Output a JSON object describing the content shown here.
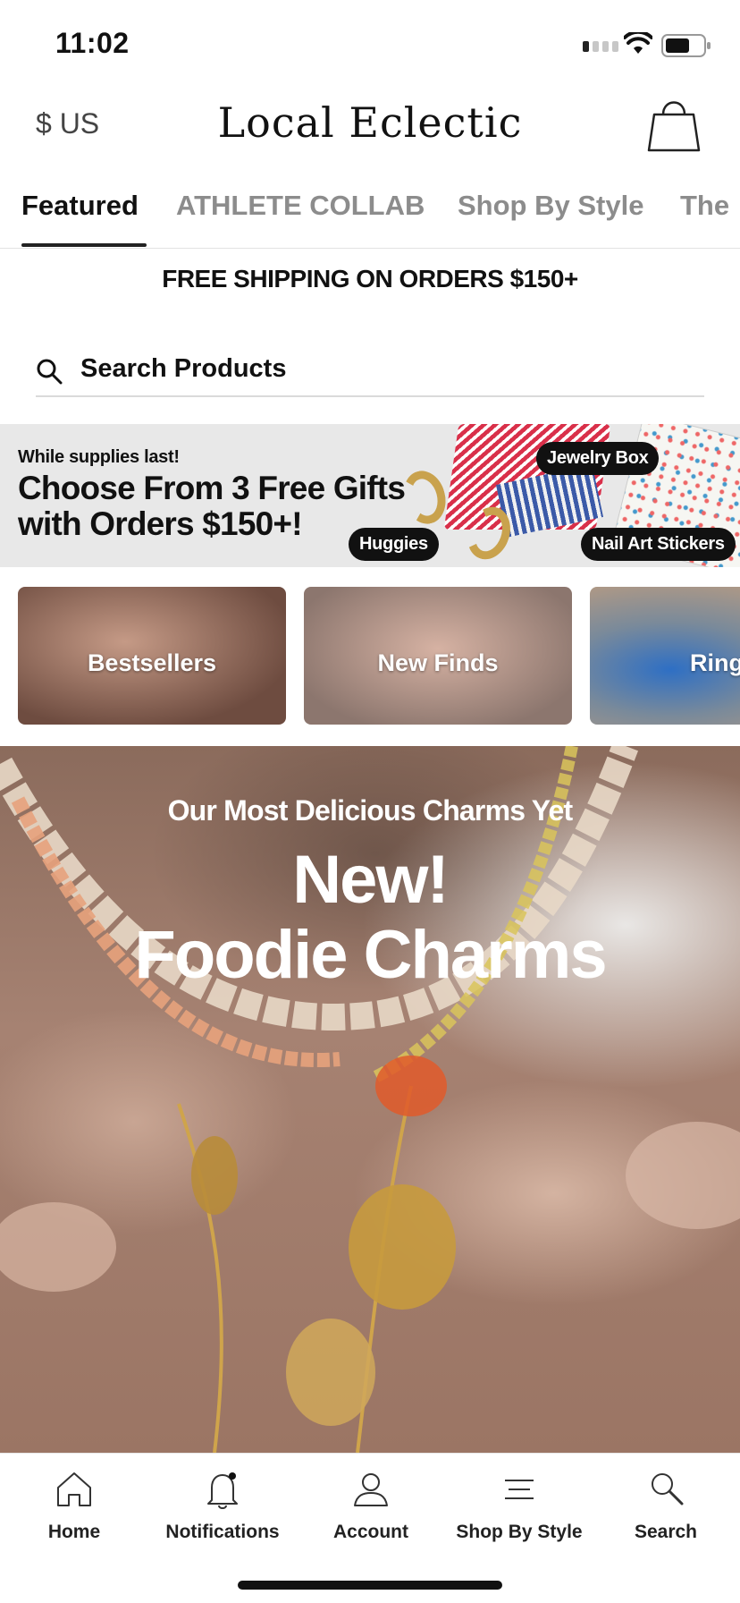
{
  "status_bar": {
    "time": "11:02"
  },
  "header": {
    "currency": "$ US",
    "brand": "Local Eclectic",
    "bag_icon": "shopping-bag-icon"
  },
  "tabs": [
    {
      "label": "Featured",
      "active": true
    },
    {
      "label": "ATHLETE COLLAB",
      "active": false
    },
    {
      "label": "Shop By Style",
      "active": false
    },
    {
      "label": "The",
      "active": false
    }
  ],
  "announcement": "FREE SHIPPING ON ORDERS $150+",
  "search": {
    "label": "Search Products",
    "icon": "search-icon"
  },
  "promo": {
    "eyebrow": "While supplies last!",
    "title": "Choose From 3 Free Gifts with Orders $150+!",
    "gifts": [
      "Jewelry Box",
      "Huggies",
      "Nail Art Stickers"
    ]
  },
  "categories": [
    {
      "label": "Bestsellers"
    },
    {
      "label": "New Finds"
    },
    {
      "label": "Ring"
    }
  ],
  "hero": {
    "subtitle": "Our Most Delicious Charms Yet",
    "title_line1": "New!",
    "title_line2": "Foodie Charms"
  },
  "bottom_nav": [
    {
      "label": "Home",
      "icon": "home-icon"
    },
    {
      "label": "Notifications",
      "icon": "bell-icon"
    },
    {
      "label": "Account",
      "icon": "user-icon"
    },
    {
      "label": "Shop By Style",
      "icon": "menu-lines-icon"
    },
    {
      "label": "Search",
      "icon": "search-icon"
    }
  ],
  "colors": {
    "accent": "#111111",
    "tab_inactive": "#8c8c8c",
    "promo_bg": "#e8e8e8"
  }
}
